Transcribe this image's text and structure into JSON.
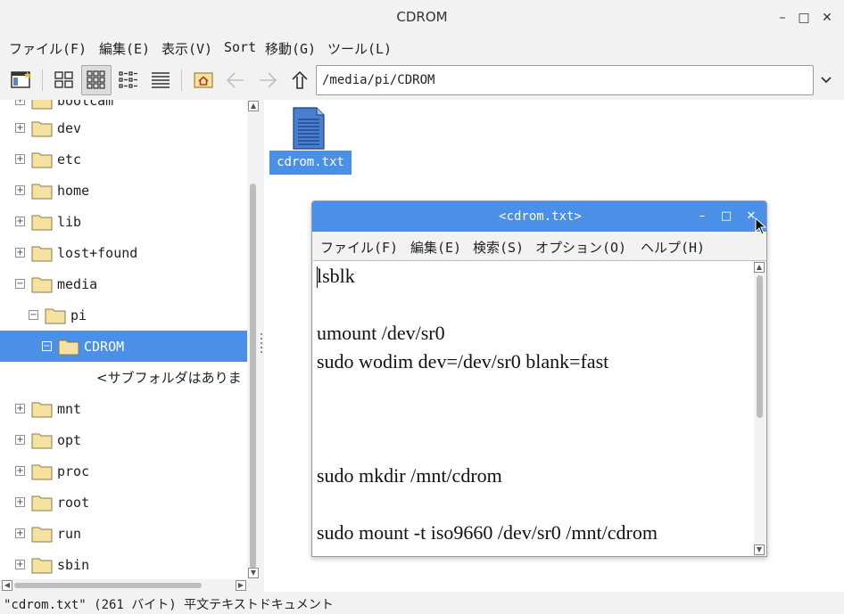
{
  "window": {
    "title": "CDROM",
    "controls": {
      "minimize": "–",
      "maximize": "□",
      "close": "✕"
    }
  },
  "menubar": {
    "items": [
      "ファイル(F)",
      "編集(E)",
      "表示(V)",
      "Sort",
      "移動(G)",
      "ツール(L)"
    ]
  },
  "toolbar": {
    "path": "/media/pi/CDROM",
    "buttons": [
      "new-window-icon",
      "icon-view-icon",
      "thumbnail-view-icon",
      "compact-view-icon",
      "detail-view-icon",
      "home-icon",
      "back-arrow-icon",
      "forward-arrow-icon",
      "up-arrow-icon"
    ],
    "active_view": "thumbnail-view-icon"
  },
  "tree": {
    "items": [
      {
        "label": "bootcam",
        "expander": "+"
      },
      {
        "label": "dev",
        "expander": "+"
      },
      {
        "label": "etc",
        "expander": "+"
      },
      {
        "label": "home",
        "expander": "+"
      },
      {
        "label": "lib",
        "expander": "+"
      },
      {
        "label": "lost+found",
        "expander": "+"
      },
      {
        "label": "media",
        "expander": "−"
      },
      {
        "label": "pi",
        "expander": "−"
      },
      {
        "label": "CDROM",
        "expander": "−",
        "selected": true
      },
      {
        "label": "<サブフォルダはありま"
      },
      {
        "label": "mnt",
        "expander": "+"
      },
      {
        "label": "opt",
        "expander": "+"
      },
      {
        "label": "proc",
        "expander": "+"
      },
      {
        "label": "root",
        "expander": "+"
      },
      {
        "label": "run",
        "expander": "+"
      },
      {
        "label": "sbin",
        "expander": "+"
      }
    ]
  },
  "files": [
    {
      "name": "cdrom.txt",
      "icon": "text-file-icon",
      "selected": true
    }
  ],
  "status": {
    "text": "\"cdrom.txt\" (261 バイト) 平文テキストドキュメント"
  },
  "editor": {
    "title": "<cdrom.txt>",
    "controls": {
      "minimize": "–",
      "maximize": "□",
      "close": "✕"
    },
    "menu": [
      "ファイル(F)",
      "編集(E)",
      "検索(S)",
      "オプション(O)",
      "ヘルプ(H)"
    ],
    "lines": [
      "lsblk",
      "",
      "umount /dev/sr0",
      "sudo wodim dev=/dev/sr0 blank=fast",
      "",
      "",
      "",
      "sudo mkdir /mnt/cdrom",
      "",
      "sudo mount -t iso9660 /dev/sr0 /mnt/cdrom"
    ]
  },
  "colors": {
    "accent": "#4a90e8",
    "background": "#f2f2f2",
    "folder": "#f6e2a0"
  }
}
